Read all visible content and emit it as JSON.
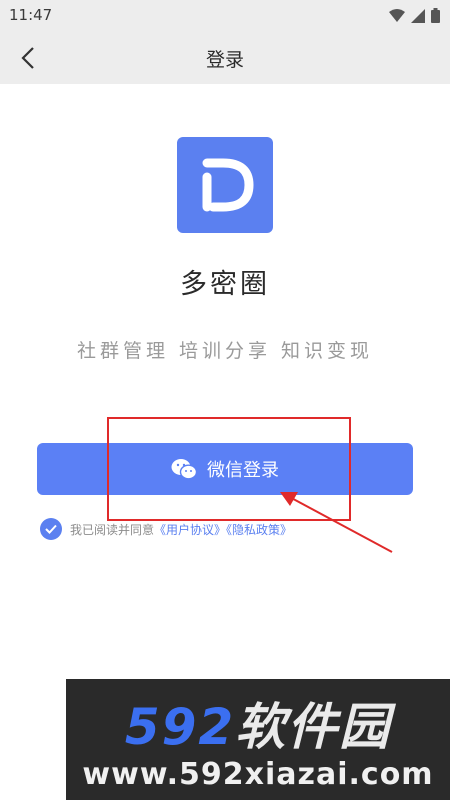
{
  "status_bar": {
    "time": "11:47"
  },
  "nav": {
    "title": "登录"
  },
  "app": {
    "name": "多密圈",
    "slogan": "社群管理 培训分享 知识变现"
  },
  "login": {
    "wechat_label": "微信登录"
  },
  "agreement": {
    "prefix": "我已阅读并同意",
    "user_agreement": "《用户协议》",
    "privacy_policy": "《隐私政策》"
  },
  "watermark": {
    "brand_number": "592",
    "brand_text": "软件园",
    "url": "www.592xiazai.com"
  },
  "colors": {
    "accent": "#5b80f5",
    "annotation": "#e02a2a"
  }
}
